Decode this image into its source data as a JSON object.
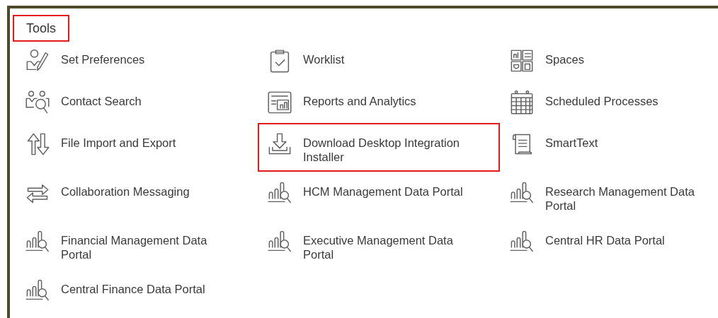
{
  "panel": {
    "title": "Tools",
    "title_highlighted": true,
    "items": [
      {
        "label": "Set Preferences",
        "kind": "person-pen",
        "highlighted": false
      },
      {
        "label": "Worklist",
        "kind": "clipboard",
        "highlighted": false
      },
      {
        "label": "Spaces",
        "kind": "tiles",
        "highlighted": false
      },
      {
        "label": "Contact Search",
        "kind": "people-search",
        "highlighted": false
      },
      {
        "label": "Reports and Analytics",
        "kind": "report",
        "highlighted": false
      },
      {
        "label": "Scheduled Processes",
        "kind": "calendar",
        "highlighted": false
      },
      {
        "label": "File Import and Export",
        "kind": "updown",
        "highlighted": false
      },
      {
        "label": "Download Desktop Integration Installer",
        "kind": "download",
        "highlighted": true
      },
      {
        "label": "SmartText",
        "kind": "scroll",
        "highlighted": false
      },
      {
        "label": "Collaboration Messaging",
        "kind": "exchange",
        "highlighted": false
      },
      {
        "label": "HCM Management Data Portal",
        "kind": "data-portal",
        "highlighted": false
      },
      {
        "label": "Research Management Data Portal",
        "kind": "data-portal",
        "highlighted": false
      },
      {
        "label": "Financial Management Data Portal",
        "kind": "data-portal",
        "highlighted": false
      },
      {
        "label": "Executive Management Data Portal",
        "kind": "data-portal",
        "highlighted": false
      },
      {
        "label": "Central HR Data Portal",
        "kind": "data-portal",
        "highlighted": false
      },
      {
        "label": "Central Finance Data Portal",
        "kind": "data-portal",
        "highlighted": false
      }
    ]
  }
}
